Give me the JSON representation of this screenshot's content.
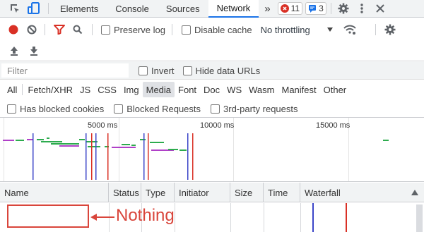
{
  "tabbar": {
    "tabs": [
      "Elements",
      "Console",
      "Sources",
      "Network"
    ],
    "active_tab": "Network",
    "more": "»",
    "errors_count": "11",
    "messages_count": "3"
  },
  "toolbar": {
    "preserve_log": "Preserve log",
    "disable_cache": "Disable cache",
    "throttling": "No throttling"
  },
  "filter": {
    "placeholder": "Filter",
    "invert": "Invert",
    "hide_data_urls": "Hide data URLs"
  },
  "type_filters": [
    "All",
    "Fetch/XHR",
    "JS",
    "CSS",
    "Img",
    "Media",
    "Font",
    "Doc",
    "WS",
    "Wasm",
    "Manifest",
    "Other"
  ],
  "selected_type": "Media",
  "blocked": {
    "has_blocked_cookies": "Has blocked cookies",
    "blocked_requests": "Blocked Requests",
    "third_party": "3rd-party requests"
  },
  "overview": {
    "ticks": [
      "5000 ms",
      "10000 ms",
      "15000 ms"
    ]
  },
  "table": {
    "columns": [
      "Name",
      "Status",
      "Type",
      "Initiator",
      "Size",
      "Time",
      "Waterfall"
    ]
  },
  "annotation": {
    "text": "Nothing",
    "arrow": "←"
  },
  "colors": {
    "accent": "#1a73e8",
    "record": "#d93025",
    "annotation": "#d9453b"
  }
}
